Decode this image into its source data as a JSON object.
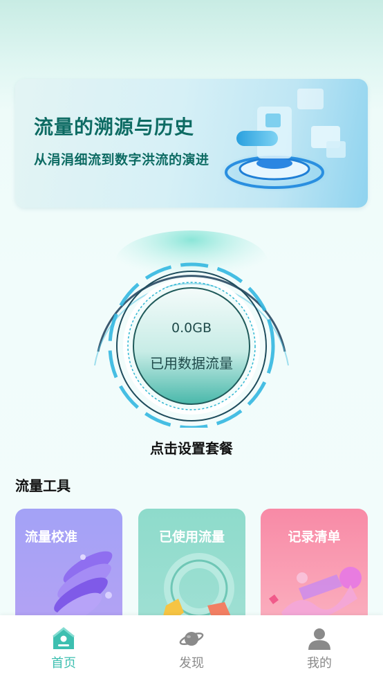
{
  "banner": {
    "title": "流量的溯源与历史",
    "subtitle": "从涓涓细流到数字洪流的演进"
  },
  "usage": {
    "value": "0.0GB",
    "label": "已用数据流量"
  },
  "set_plan_label": "点击设置套餐",
  "tools": {
    "title": "流量工具",
    "cards": [
      {
        "label": "流量校准",
        "color_top": "#a8a6f7",
        "color_bottom": "#b7a2f6"
      },
      {
        "label": "已使用流量",
        "color_top": "#8fdccd",
        "color_bottom": "#a2e0d5"
      },
      {
        "label": "记录清单",
        "color_top": "#f98ca7",
        "color_bottom": "#fbb0bf"
      }
    ]
  },
  "tabbar": {
    "items": [
      {
        "label": "首页",
        "icon": "home-icon",
        "active": true
      },
      {
        "label": "发现",
        "icon": "planet-icon",
        "active": false
      },
      {
        "label": "我的",
        "icon": "user-icon",
        "active": false
      }
    ],
    "active_color": "#3dbfb0",
    "inactive_color": "#8a8a8a"
  }
}
